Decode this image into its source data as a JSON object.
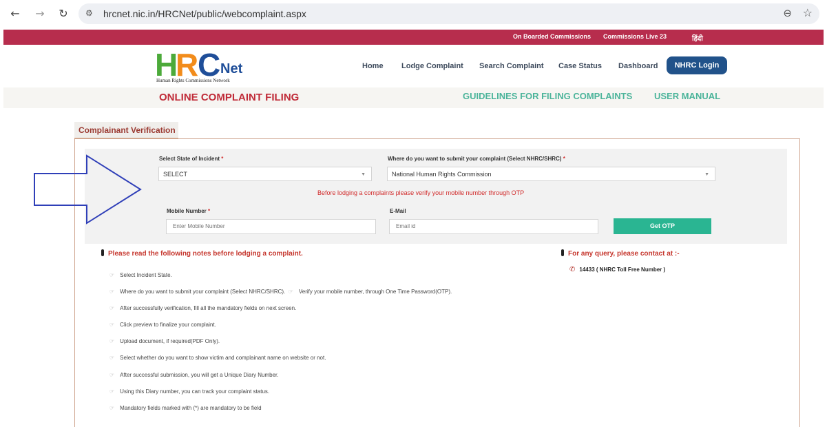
{
  "browser": {
    "url": "hrcnet.nic.in/HRCNet/public/webcomplaint.aspx",
    "back_icon": "←",
    "forward_icon": "→",
    "reload_icon": "↻",
    "site_info_icon": "⚙",
    "zoom_icon": "⊖",
    "bookmark_icon": "☆"
  },
  "topstrip": {
    "onboarded": "On Boarded Commissions",
    "live": "Commissions Live 23",
    "hindi": "हिंदी"
  },
  "logo": {
    "h": "H",
    "r": "R",
    "c": "C",
    "net": "Net",
    "tagline": "Human Rights Commissions Network"
  },
  "nav": {
    "home": "Home",
    "lodge": "Lodge Complaint",
    "search": "Search Complaint",
    "status": "Case Status",
    "dashboard": "Dashboard",
    "login": "NHRC Login"
  },
  "subbar": {
    "title": "ONLINE COMPLAINT FILING",
    "guidelines": "GUIDELINES FOR FILING COMPLAINTS",
    "manual": "USER MANUAL"
  },
  "verification": {
    "tab": "Complainant Verification",
    "state_label": "Select State of Incident",
    "state_value": "SELECT",
    "submit_label": "Where do you want to submit your complaint (Select NHRC/SHRC)",
    "submit_value": "National Human Rights Commission",
    "required_mark": "*",
    "warning": "Before lodging a complaints please verify your mobile number through OTP",
    "mobile_label": "Mobile Number",
    "mobile_placeholder": "Enter Mobile Number",
    "email_label": "E-Mail",
    "email_placeholder": "Email id",
    "otp_button": "Get OTP",
    "dropdown_icon": "▼"
  },
  "notes": {
    "heading": "Please read the following notes before lodging a complaint.",
    "hand_icon": "☞",
    "items": [
      "Select Incident State.",
      "Where do you want to submit your complaint (Select NHRC/SHRC).",
      "After successfully verification, fill all the mandatory fields on next screen.",
      "Click preview to finalize your complaint.",
      "Upload document, if required(PDF Only).",
      "Select whether do you want to show victim and complainant name on website or not.",
      "After successful submission, you will get a Unique Diary Number.",
      "Using this Diary number, you can track your complaint status.",
      "Mandatory fields marked with (*) are mandatory to be field"
    ],
    "inline_item": "Verify your mobile number, through One Time Password(OTP)."
  },
  "contact": {
    "heading": "For any query, please contact at :-",
    "phone_icon": "✆",
    "phone": "14433 ( NHRC Toll Free Number )"
  }
}
